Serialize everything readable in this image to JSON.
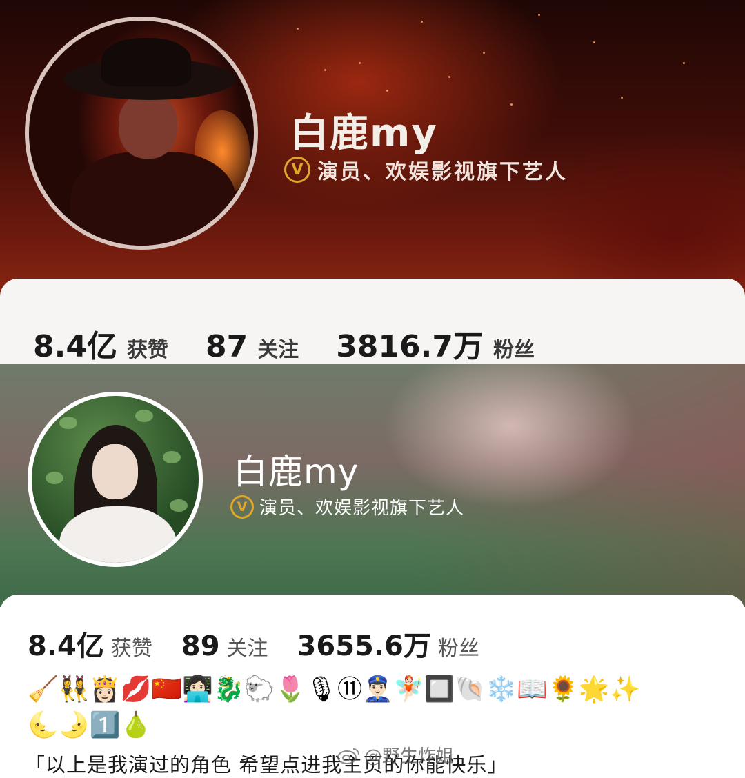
{
  "top_profile": {
    "name": "白鹿my",
    "verified_title": "演员、欢娱影视旗下艺人",
    "stats": [
      {
        "value": "8.4亿",
        "label": "获赞"
      },
      {
        "value": "87",
        "label": "关注"
      },
      {
        "value": "3816.7万",
        "label": "粉丝"
      }
    ]
  },
  "bottom_profile": {
    "name": "白鹿my",
    "verified_title": "演员、欢娱影视旗下艺人",
    "stats": [
      {
        "value": "8.4亿",
        "label": "获赞"
      },
      {
        "value": "89",
        "label": "关注"
      },
      {
        "value": "3655.6万",
        "label": "粉丝"
      }
    ],
    "emoji_line1": "🧹👯‍♀️👸🏻💋🇨🇳👩🏻‍💻🐉🐑🌷🎙⑪👮🏻‍♂️🧚🏻🔲🐚❄️📖🌻🌟✨",
    "emoji_line2": "🌜🌛1️⃣🍐",
    "bio": "「以上是我演过的角色 希望点进我主页的你能快乐」"
  },
  "verify_icon": "v-verified-icon",
  "watermark": {
    "text": "@野生炸姐",
    "icon": "weibo-logo-icon"
  },
  "colors": {
    "verify_gold": "#e0a62a",
    "top_banner": "#3e0d08",
    "bottom_banner": "#4e7653"
  }
}
